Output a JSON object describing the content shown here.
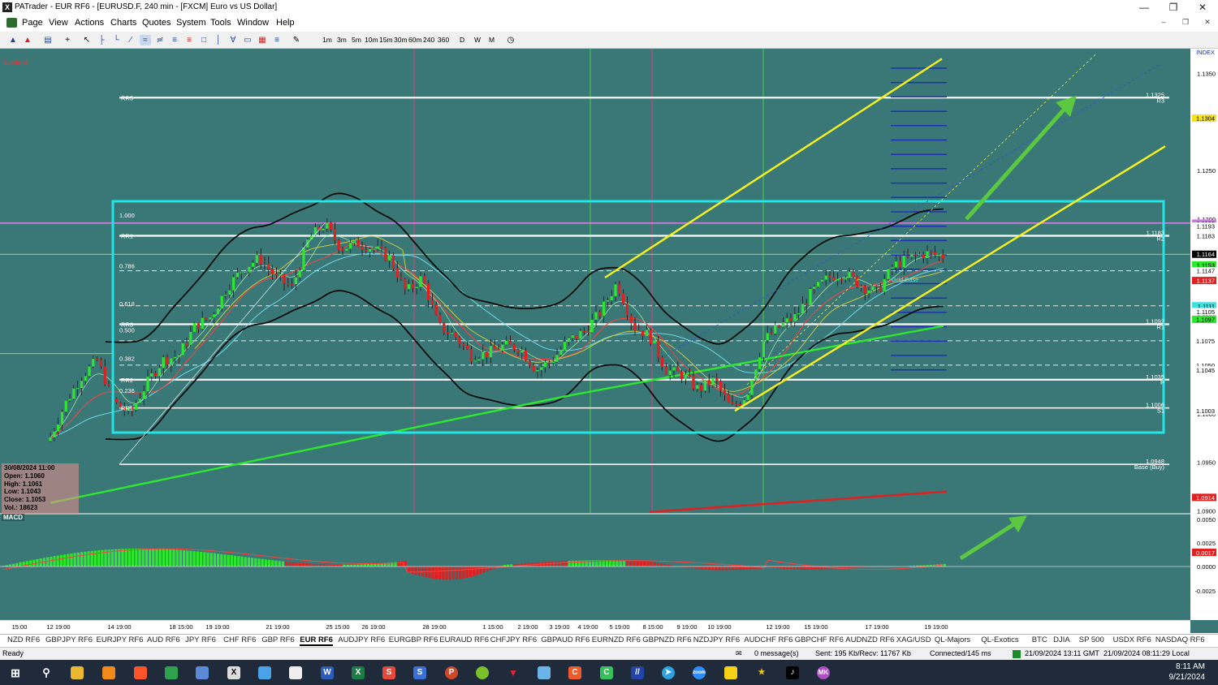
{
  "window": {
    "title": "PATrader - EUR RF6 - [EURUSD.F, 240 min - [FXCM] Euro vs US Dollar]",
    "app_icon": "X"
  },
  "menu": [
    "Page",
    "View",
    "Actions",
    "Charts",
    "Quotes",
    "System",
    "Tools",
    "Window",
    "Help"
  ],
  "timeframes": [
    "1m",
    "3m",
    "5m",
    "10m",
    "15m",
    "30m",
    "60m",
    "240",
    "360",
    "D",
    "W",
    "M"
  ],
  "chart": {
    "locked_label": "Locked",
    "price_axis_header": "INDEX",
    "price_ticks": [
      "1.1350",
      "1.1250",
      "1.1200",
      "1.1150",
      "1.1100",
      "1.1050",
      "1.1000",
      "1.0950",
      "1.0900"
    ],
    "tags": [
      {
        "price": "1.1304",
        "kind": "yellow"
      },
      {
        "price": "1.1196",
        "kind": "violet"
      },
      {
        "price": "1.1193",
        "kind": "yellowline"
      },
      {
        "price": "1.1183",
        "kind": "plain"
      },
      {
        "price": "1.1164",
        "kind": "black"
      },
      {
        "price": "1.1153",
        "kind": "green"
      },
      {
        "price": "1.1147",
        "kind": "plain"
      },
      {
        "price": "1.1137",
        "kind": "red"
      },
      {
        "price": "1.1111",
        "kind": "cyan"
      },
      {
        "price": "1.1105",
        "kind": "plain"
      },
      {
        "price": "1.1097",
        "kind": "green"
      },
      {
        "price": "1.1075",
        "kind": "plain"
      },
      {
        "price": "1.1050",
        "kind": "plain"
      },
      {
        "price": "1.1045",
        "kind": "plain"
      },
      {
        "price": "1.1003",
        "kind": "plain"
      },
      {
        "price": "1.0914",
        "kind": "red"
      }
    ],
    "fib_levels": [
      "1.000",
      "0.786",
      "0.618",
      "0.500",
      "0.382",
      "0.236"
    ],
    "range_labels": [
      "RR5",
      "RR1",
      "RR3",
      "RR2",
      "RR1"
    ],
    "pivots": [
      {
        "value": "1.1325",
        "tag": "R3"
      },
      {
        "value": "1.1183",
        "tag": "R2"
      },
      {
        "value": "1.1092",
        "tag": "R1"
      },
      {
        "value": "1.1035",
        "tag": "P"
      },
      {
        "value": "1.1006",
        "tag": "S1"
      },
      {
        "value": "1.0948",
        "tag": "Base (Buy)"
      }
    ],
    "annotation": "Grid Base",
    "time_labels": [
      "15:00",
      "12 19:00",
      "14 19:00",
      "18 15:00",
      "19 19:00",
      "21 19:00",
      "25 15:00",
      "26 19:00",
      "28 19:00",
      "1 15:00",
      "2 19:00",
      "3 19:00",
      "4 19:00",
      "5 19:00",
      "8 15:00",
      "9 19:00",
      "10 19:00",
      "12 19:00",
      "15 19:00",
      "17 19:00",
      "19 19:00"
    ],
    "ohlc": {
      "date": "30/08/2024 11:00",
      "open": "Open: 1.1060",
      "high": "High: 1.1061",
      "low": "Low: 1.1043",
      "close": "Close: 1.1053",
      "vol": "Vol.: 18623"
    },
    "macd": {
      "label": "MACD",
      "ticks": [
        "0.0050",
        "0.0025",
        "0.0000",
        "-0.0025"
      ],
      "tag": "0.0017"
    }
  },
  "tabs": [
    "NZD RF6",
    "GBPJPY RF6",
    "EURJPY RF6",
    "AUD RF6",
    "JPY RF6",
    "CHF RF6",
    "GBP RF6",
    "EUR RF6",
    "AUDJPY RF6",
    "EURGBP RF6",
    "EURAUD RF6",
    "CHFJPY RF6",
    "GBPAUD RF6",
    "EURNZD RF6",
    "GBPNZD RF6",
    "NZDJPY RF6",
    "AUDCHF RF6",
    "GBPCHF RF6",
    "AUDNZD RF6",
    "XAG/USD",
    "QL-Majors",
    "QL-Exotics",
    "BTC",
    "DJIA",
    "SP 500",
    "USDX RF6",
    "NASDAQ RF6"
  ],
  "active_tab": "EUR RF6",
  "status": {
    "ready": "Ready",
    "messages": "0 message(s)",
    "traffic": "Sent: 195 Kb/Recv: 11767 Kb",
    "conn": "Connected/145 ms",
    "gmt": "21/09/2024 13:11 GMT",
    "local": "21/09/2024 08:11:29 Local"
  },
  "clock": {
    "time": "8:11 AM",
    "date": "9/21/2024"
  },
  "colors": {
    "chart_bg": "#3a7878",
    "bull": "#2ee62e",
    "bear": "#e02020",
    "fib_box": "#22e5e5",
    "trendline": "#f2ef22"
  }
}
